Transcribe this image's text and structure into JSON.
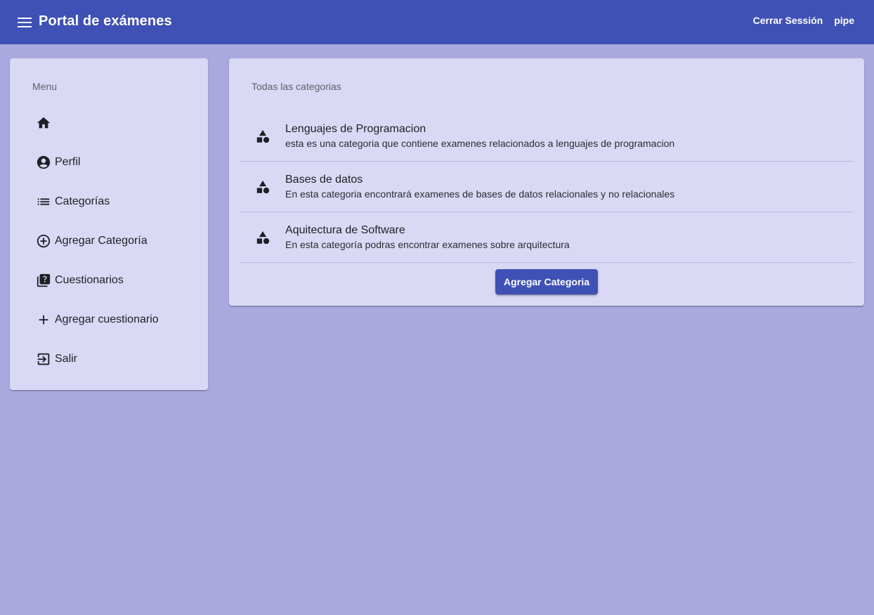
{
  "header": {
    "title": "Portal de exámenes",
    "logout_label": "Cerrar Sessión",
    "username": "pipe"
  },
  "sidebar": {
    "subheader": "Menu",
    "items": [
      {
        "label": "",
        "icon": "home-icon"
      },
      {
        "label": "Perfil",
        "icon": "account-circle-icon"
      },
      {
        "label": "Categorías",
        "icon": "list-icon"
      },
      {
        "label": "Agregar Categoría",
        "icon": "add-circle-icon"
      },
      {
        "label": "Cuestionarios",
        "icon": "quiz-icon"
      },
      {
        "label": "Agregar cuestionario",
        "icon": "add-icon"
      },
      {
        "label": "Salir",
        "icon": "logout-icon"
      }
    ]
  },
  "main": {
    "subheader": "Todas las categorias",
    "categories": [
      {
        "title": "Lenguajes de Programacion",
        "description": "esta es una categoria que contiene examenes relacionados a lenguajes de programacion",
        "icon": "category-icon"
      },
      {
        "title": "Bases de datos",
        "description": "En esta categoria encontrará examenes de bases de datos relacionales y no relacionales",
        "icon": "category-icon"
      },
      {
        "title": "Aquitectura de Software",
        "description": "En esta categoría podras encontrar examenes sobre arquitectura",
        "icon": "category-icon"
      }
    ],
    "add_button_label": "Agregar Categoria"
  },
  "colors": {
    "primary": "#3f51b5",
    "background": "#a9a9df",
    "card": "#d9d9f6"
  }
}
